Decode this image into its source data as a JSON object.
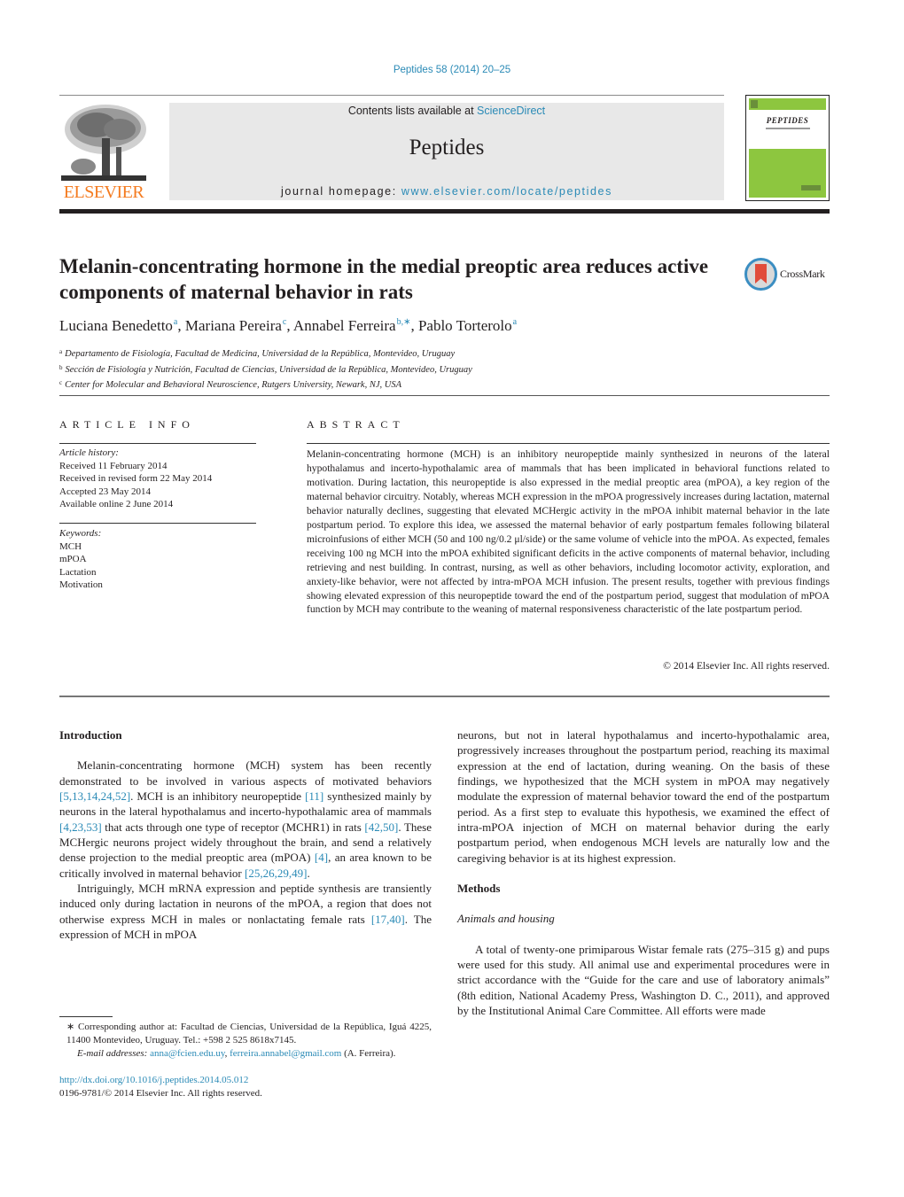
{
  "header": {
    "citation": "Peptides 58 (2014) 20–25",
    "contents_prefix": "Contents lists available at ",
    "contents_link": "ScienceDirect",
    "journal_name": "Peptides",
    "homepage_prefix": "journal homepage: ",
    "homepage_url": "www.elsevier.com/locate/peptides",
    "publisher": "ELSEVIER",
    "cover_title": "PEPTIDES"
  },
  "article": {
    "title": "Melanin-concentrating hormone in the medial preoptic area reduces active components of maternal behavior in rats",
    "crossmark_label": "CrossMark",
    "authors": [
      {
        "name": "Luciana Benedetto",
        "sup": "a",
        "sep": ", "
      },
      {
        "name": "Mariana Pereira",
        "sup": "c",
        "sep": ", "
      },
      {
        "name": "Annabel Ferreira",
        "sup": "b,∗",
        "sep": ", "
      },
      {
        "name": "Pablo Torterolo",
        "sup": "a",
        "sep": ""
      }
    ],
    "affiliations": [
      {
        "key": "a",
        "text": "Departamento de Fisiología, Facultad de Medicina, Universidad de la República, Montevideo, Uruguay"
      },
      {
        "key": "b",
        "text": "Sección de Fisiología y Nutrición, Facultad de Ciencias, Universidad de la República, Montevideo, Uruguay"
      },
      {
        "key": "c",
        "text": "Center for Molecular and Behavioral Neuroscience, Rutgers University, Newark, NJ, USA"
      }
    ]
  },
  "article_info": {
    "heading": "ARTICLE INFO",
    "history_label": "Article history:",
    "history": [
      "Received 11 February 2014",
      "Received in revised form 22 May 2014",
      "Accepted 23 May 2014",
      "Available online 2 June 2014"
    ],
    "keywords_label": "Keywords:",
    "keywords": [
      "MCH",
      "mPOA",
      "Lactation",
      "Motivation"
    ]
  },
  "abstract": {
    "heading": "ABSTRACT",
    "text": "Melanin-concentrating hormone (MCH) is an inhibitory neuropeptide mainly synthesized in neurons of the lateral hypothalamus and incerto-hypothalamic area of mammals that has been implicated in behav­ioral functions related to motivation. During lactation, this neuropeptide is also expressed in the medial preoptic area (mPOA), a key region of the maternal behavior circuitry. Notably, whereas MCH expression in the mPOA progressively increases during lactation, maternal behavior naturally declines, suggesting that elevated MCHergic activity in the mPOA inhibit maternal behavior in the late postpartum period. To explore this idea, we assessed the maternal behavior of early postpartum females following bilateral microinfusions of either MCH (50 and 100 ng/0.2 μl/side) or the same volume of vehicle into the mPOA. As expected, females receiving 100 ng MCH into the mPOA exhibited significant deficits in the active components of maternal behavior, including retrieving and nest building. In contrast, nursing, as well as other behaviors, including locomotor activity, exploration, and anxiety-like behavior, were not affected by intra-mPOA MCH infusion. The present results, together with previous findings showing elevated expression of this neuropeptide toward the end of the postpartum period, suggest that modulation of mPOA function by MCH may contribute to the weaning of maternal responsiveness characteristic of the late postpartum period.",
    "copyright": "© 2014 Elsevier Inc. All rights reserved."
  },
  "body": {
    "intro_heading": "Introduction",
    "intro_p1": [
      {
        "t": "Melanin-concentrating hormone (MCH) system has been recently demonstrated to be involved in various aspects of moti­vated behaviors "
      },
      {
        "ref": "[5,13,14,24,52]"
      },
      {
        "t": ". MCH is an inhibitory neuropeptide "
      },
      {
        "ref": "[11]"
      },
      {
        "t": " synthesized mainly by neurons in the lateral hypothala­mus and incerto-hypothalamic area of mammals "
      },
      {
        "ref": "[4,23,53]"
      },
      {
        "t": " that acts through one type of receptor (MCHR1) in rats "
      },
      {
        "ref": "[42,50]"
      },
      {
        "t": ". These MCHergic neurons project widely throughout the brain, and send a relatively dense projection to the medial preoptic area (mPOA) "
      },
      {
        "ref": "[4]"
      },
      {
        "t": ", an area known to be critically involved in maternal behavior "
      },
      {
        "ref": "[25,26,29,49]"
      },
      {
        "t": "."
      }
    ],
    "intro_p2": [
      {
        "t": "Intriguingly, MCH mRNA expression and peptide synthesis are transiently induced only during lactation in neurons of the mPOA, a region that does not otherwise express MCH in males or non­lactating female rats "
      },
      {
        "ref": "[17,40]"
      },
      {
        "t": ". The expression of MCH in mPOA"
      }
    ],
    "right_p1": "neurons, but not in lateral hypothalamus and incerto-hypothalamic area, progressively increases throughout the postpartum period, reaching its maximal expression at the end of lactation, during weaning. On the basis of these findings, we hypothesized that the MCH system in mPOA may negatively modulate the expression of maternal behavior toward the end of the postpartum period. As a first step to evaluate this hypothesis, we examined the effect of intra-mPOA injection of MCH on maternal behavior during the early postpartum period, when endogenous MCH levels are naturally low and the caregiving behavior is at its highest expression.",
    "methods_heading": "Methods",
    "animals_heading": "Animals and housing",
    "animals_p1": "A total of twenty-one primiparous Wistar female rats (275–315 g) and pups were used for this study. All animal use and experimental procedures were in strict accordance with the “Guide for the care and use of laboratory animals” (8th edition, National Academy Press, Washington D. C., 2011), and approved by the Institutional Animal Care Committee. All efforts were made"
  },
  "footnote": {
    "corresponding": "∗ Corresponding author at: Facultad de Ciencias, Universidad de la República, Iguá 4225, 11400 Montevideo, Uruguay. Tel.: +598 2 525 8618x7145.",
    "email_label": "E-mail addresses: ",
    "email1": "anna@fcien.edu.uy",
    "email_sep": ", ",
    "email2": "ferreira.annabel@gmail.com",
    "email_suffix": " (A. Ferreira)."
  },
  "doi": {
    "url": "http://dx.doi.org/10.1016/j.peptides.2014.05.012",
    "issn": "0196-9781/© 2014 Elsevier Inc. All rights reserved."
  }
}
